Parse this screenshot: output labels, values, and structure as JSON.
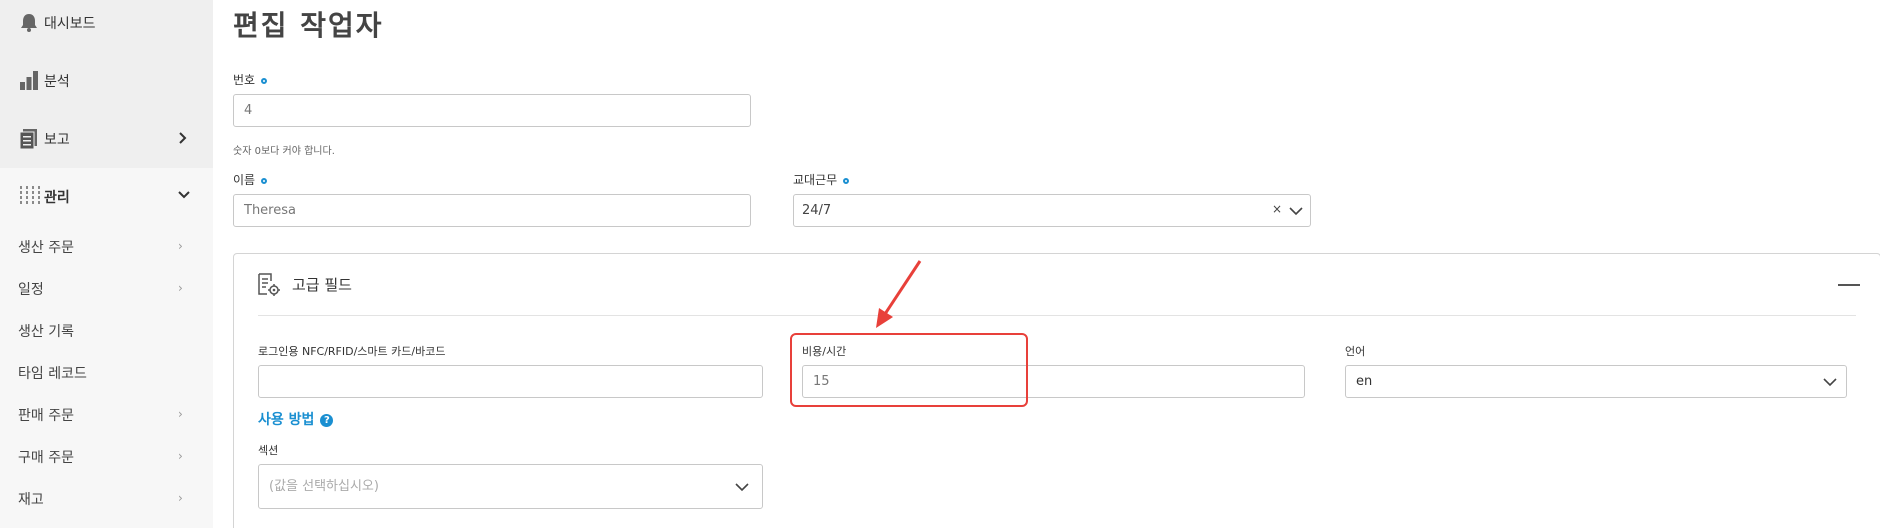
{
  "sidebar": {
    "items": [
      {
        "label": "대시보드",
        "icon": "bell-icon"
      },
      {
        "label": "분석",
        "icon": "bar-chart-icon"
      },
      {
        "label": "보고",
        "icon": "report-icon"
      },
      {
        "label": "관리",
        "icon": "sliders-icon"
      }
    ],
    "sub_items": [
      {
        "label": "생산 주문"
      },
      {
        "label": "일정"
      },
      {
        "label": "생산 기록"
      },
      {
        "label": "타임 레코드"
      },
      {
        "label": "판매 주문"
      },
      {
        "label": "구매 주문"
      },
      {
        "label": "재고"
      }
    ]
  },
  "page": {
    "title": "편집 작업자"
  },
  "form": {
    "number": {
      "label": "번호",
      "value": "4",
      "hint": "숫자 0보다 커야 합니다."
    },
    "name": {
      "label": "이름",
      "value": "Theresa"
    },
    "shift": {
      "label": "교대근무",
      "value": "24/7",
      "clear": "×"
    },
    "advanced": {
      "title": "고급 필드",
      "login_nfc": {
        "label": "로그인용 NFC/RFID/스마트 카드/바코드",
        "value": ""
      },
      "cost_per_hour": {
        "label": "비용/시간",
        "value": "15"
      },
      "language": {
        "label": "언어",
        "value": "en"
      },
      "how_to_use": {
        "label": "사용 방법",
        "help": "?"
      },
      "section": {
        "label": "섹션",
        "placeholder": "(값을 선택하십시오)"
      }
    }
  },
  "colors": {
    "accent": "#1a8fd1",
    "annotation": "#e8403a"
  }
}
